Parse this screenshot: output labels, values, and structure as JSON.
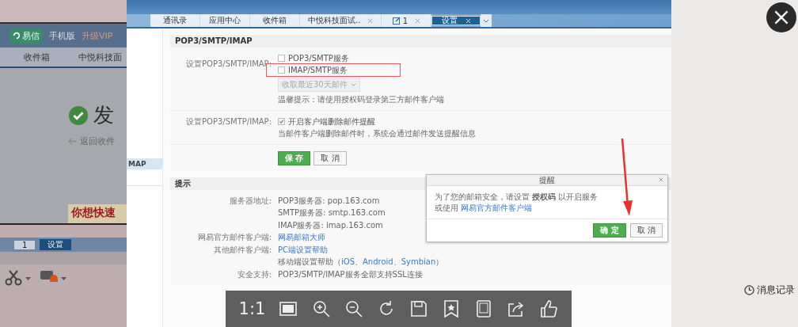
{
  "background_app": {
    "brand": "易信",
    "nav": [
      "手机版",
      "升级VIP"
    ],
    "tabs": [
      "收件箱",
      "中悦科技面"
    ],
    "heading": "发",
    "back_link": "返回收件",
    "banner": "你想快速",
    "mini_tabs": [
      {
        "label": "1",
        "selected": false
      },
      {
        "label": "设置",
        "selected": true
      }
    ]
  },
  "viewer": {
    "tabs": [
      {
        "label": "通讯录",
        "kind": "plain",
        "selected": false
      },
      {
        "label": "应用中心",
        "kind": "plain",
        "selected": false
      },
      {
        "label": "收件箱",
        "kind": "plain",
        "selected": false
      },
      {
        "label": "中悦科技面试..",
        "kind": "closable",
        "selected": false
      },
      {
        "label": "1",
        "kind": "compose",
        "selected": false
      },
      {
        "label": "设置",
        "kind": "closable",
        "selected": true
      }
    ],
    "sidebar": {
      "items": [
        {
          "label": "MAP",
          "selected": true
        }
      ]
    },
    "pop_section": {
      "title": "POP3/SMTP/IMAP",
      "service_label": "设置POP3/SMTP/IMAP:",
      "services": [
        {
          "label": "POP3/SMTP服务",
          "checked": false,
          "highlighted": false
        },
        {
          "label": "IMAP/SMTP服务",
          "checked": false,
          "highlighted": true
        }
      ],
      "fetch_select": {
        "value": "收取最近30天邮件",
        "disabled": true
      },
      "hint": "温馨提示：请使用授权码登录第三方邮件客户端",
      "reminder_label": "设置POP3/SMTP/IMAP:",
      "reminder": {
        "label": "开启客户端删除邮件提醒",
        "checked": true
      },
      "reminder_note": "当邮件客户端删除邮件时，系统会通过邮件发送提醒信息",
      "save": "保 存",
      "cancel": "取 消"
    },
    "tips_section": {
      "title": "提示",
      "rows": [
        {
          "label": "服务器地址:",
          "segments": [
            {
              "text": "POP3服务器: pop.163.com",
              "link": false
            }
          ]
        },
        {
          "segments": [
            {
              "text": "SMTP服务器: smtp.163.com",
              "link": false
            }
          ]
        },
        {
          "segments": [
            {
              "text": "IMAP服务器: imap.163.com",
              "link": false
            }
          ]
        },
        {
          "label": "网易官方邮件客户端:",
          "segments": [
            {
              "text": "网易邮箱大师",
              "link": true
            }
          ]
        },
        {
          "label": "其他邮件客户端:",
          "segments": [
            {
              "text": "PC端设置帮助",
              "link": true
            }
          ]
        },
        {
          "segments": [
            {
              "text": "移动端设置帮助（",
              "link": false
            },
            {
              "text": "iOS",
              "link": true
            },
            {
              "text": "Android",
              "link": true
            },
            {
              "text": "Symbian",
              "link": true
            },
            {
              "text": "）",
              "link": false
            }
          ],
          "separator": "、"
        },
        {
          "label": "安全支持:",
          "segments": [
            {
              "text": "POP3/SMTP/IMAP服务全部支持SSL连接",
              "link": false
            }
          ]
        }
      ]
    },
    "dialog": {
      "title": "提醒",
      "message": "为了您的邮箱安全，请设置 **授权码** 以开启服务",
      "alt_prefix": "或使用",
      "alt_link": "网易官方邮件客户端",
      "ok": "确 定",
      "cancel": "取 消"
    }
  },
  "toolbar": {
    "ratio_label": "1:1"
  },
  "side_panel": {
    "history_label": "消息记录"
  }
}
